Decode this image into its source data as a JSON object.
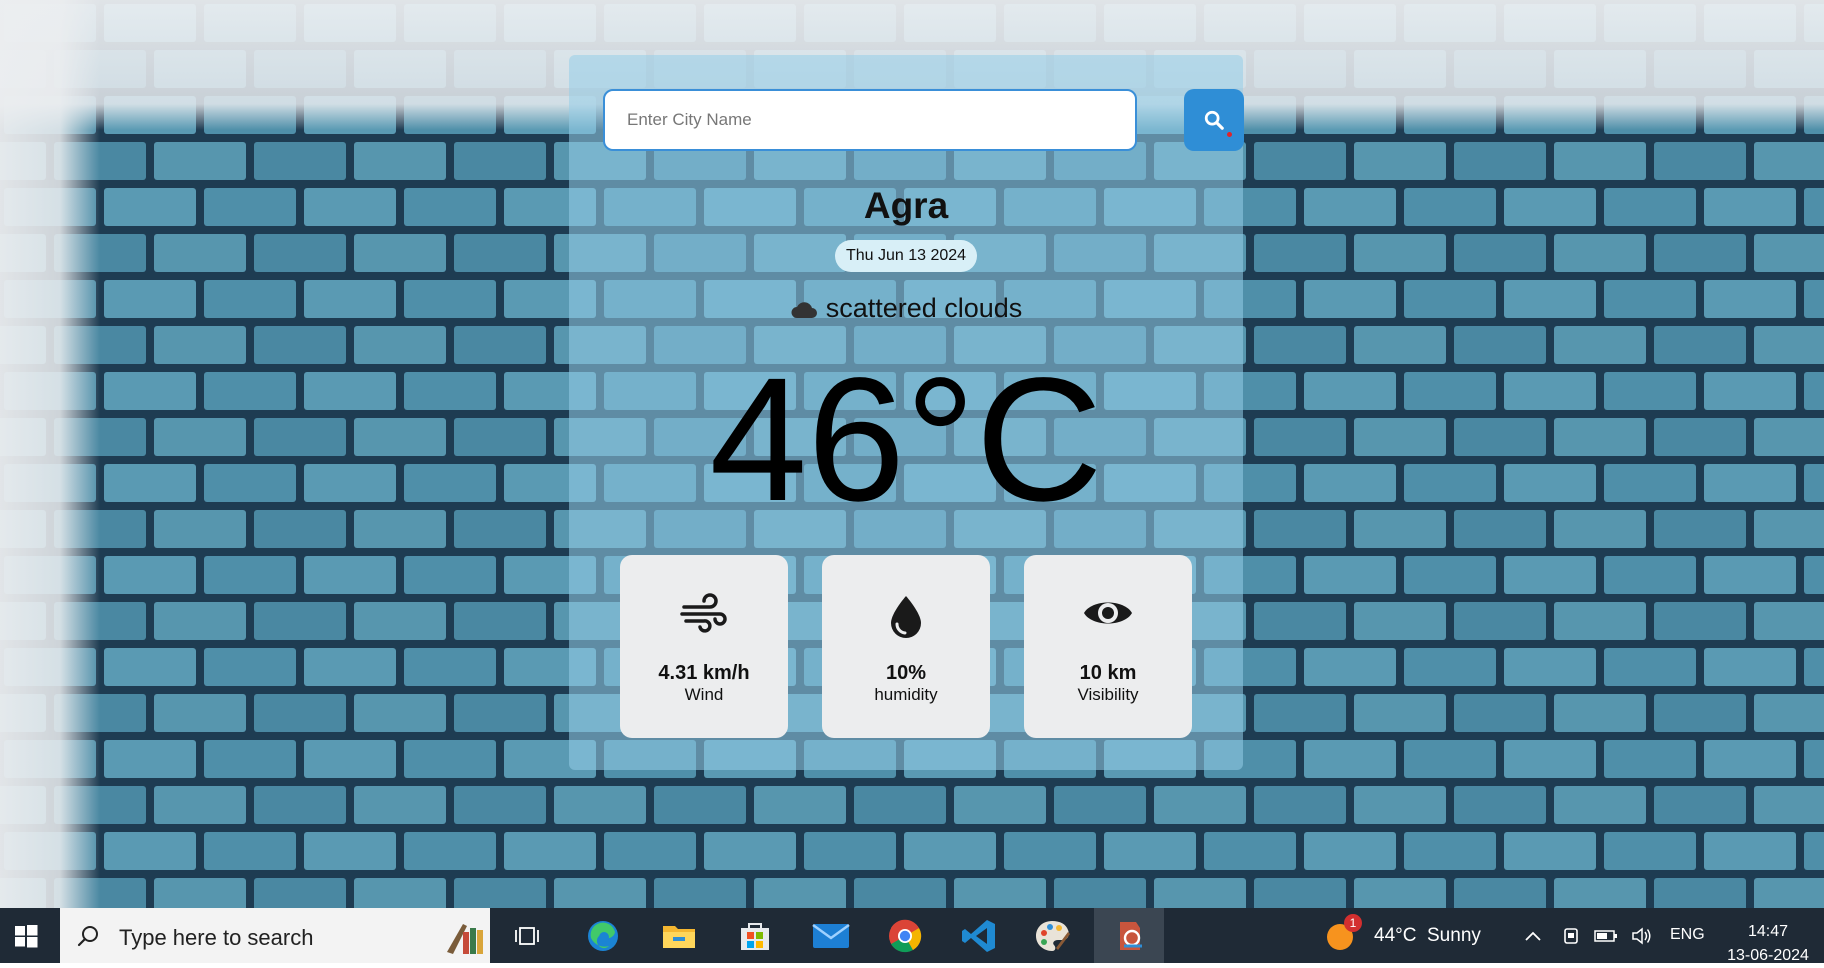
{
  "search": {
    "placeholder": "Enter City Name",
    "value": "",
    "button_icon": "search-icon"
  },
  "weather": {
    "city": "Agra",
    "date": "Thu Jun 13 2024",
    "condition_icon": "cloud-icon",
    "description": "scattered clouds",
    "temperature": "46°C",
    "stats": [
      {
        "icon": "wind-icon",
        "value": "4.31 km/h",
        "label": "Wind"
      },
      {
        "icon": "droplet-icon",
        "value": "10%",
        "label": "humidity"
      },
      {
        "icon": "eye-icon",
        "value": "10 km",
        "label": "Visibility"
      }
    ]
  },
  "colors": {
    "accent": "#2f8ed6",
    "card_bg": "#96cde8",
    "stat_bg": "#ecedee",
    "taskbar": "#1f2a36"
  },
  "taskbar": {
    "search_placeholder": "Type here to search",
    "apps": [
      "task-view-icon",
      "edge-icon",
      "file-explorer-icon",
      "store-icon",
      "mail-icon",
      "chrome-icon",
      "vscode-icon",
      "paint-icon",
      "active-app-icon"
    ],
    "weather_badge": "1",
    "weather_text": "44°C  Sunny",
    "language": "ENG",
    "time": "14:47",
    "date": "13-06-2024"
  }
}
